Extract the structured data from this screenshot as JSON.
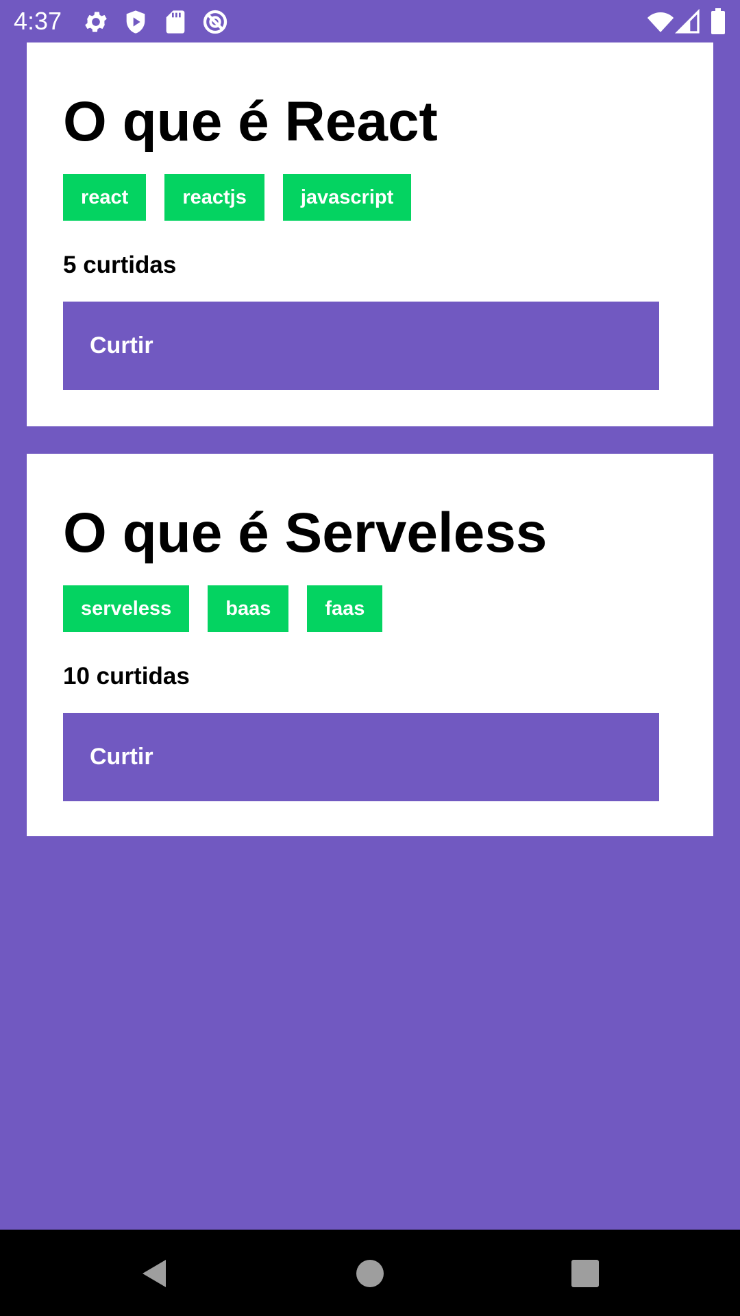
{
  "status_bar": {
    "time": "4:37",
    "left_icons": [
      "gear-icon",
      "shield-play-icon",
      "sd-card-icon",
      "no-disturb-icon"
    ],
    "right_icons": [
      "wifi-icon",
      "cell-signal-icon",
      "battery-icon"
    ]
  },
  "colors": {
    "background": "#7159c1",
    "card": "#ffffff",
    "tag": "#04d361",
    "button": "#7159c1"
  },
  "repositories": [
    {
      "title": "O que é React",
      "techs": [
        "react",
        "reactjs",
        "javascript"
      ],
      "likes": "5 curtidas",
      "button_label": "Curtir"
    },
    {
      "title": "O que é Serveless",
      "techs": [
        "serveless",
        "baas",
        "faas"
      ],
      "likes": "10 curtidas",
      "button_label": "Curtir"
    }
  ],
  "nav_bar": {
    "buttons": [
      "back-icon",
      "home-icon",
      "recents-icon"
    ]
  }
}
